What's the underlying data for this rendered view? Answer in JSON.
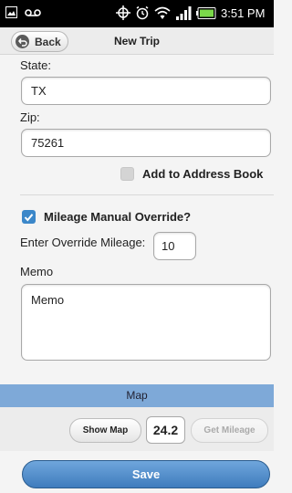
{
  "statusbar": {
    "time": "3:51 PM"
  },
  "header": {
    "back_label": "Back",
    "title": "New Trip"
  },
  "form": {
    "state_label": "State:",
    "state_value": "TX",
    "zip_label": "Zip:",
    "zip_value": "75261",
    "address_book_label": "Add to Address Book",
    "mileage_override_label": "Mileage Manual Override?",
    "override_mileage_label": "Enter Override Mileage:",
    "override_mileage_value": "10",
    "memo_label": "Memo",
    "memo_value": "Memo"
  },
  "map": {
    "section_label": "Map",
    "show_map_label": "Show Map",
    "mileage_value": "24.2",
    "get_mileage_label": "Get Mileage"
  },
  "footer": {
    "save_label": "Save"
  },
  "colors": {
    "accent": "#3f7cbd",
    "map_bar": "#7ea9d8",
    "checkbox": "#3b87c9"
  }
}
